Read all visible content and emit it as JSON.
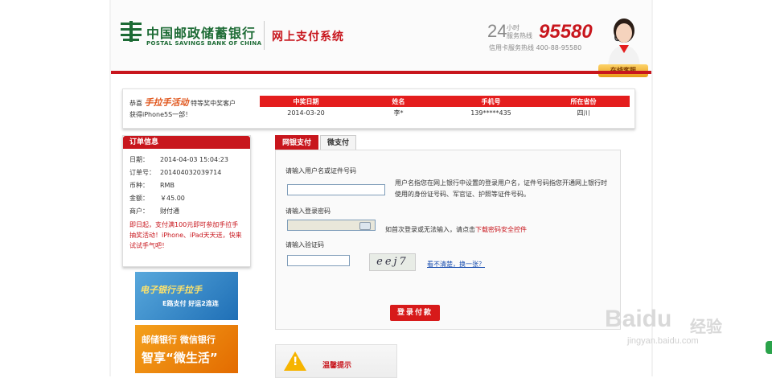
{
  "header": {
    "bank_name_cn": "中国邮政储蓄银行",
    "bank_name_en": "POSTAL SAVINGS BANK OF CHINA",
    "system_title": "网上支付系统",
    "hotline_24": "24",
    "hotline_small_1": "小时",
    "hotline_small_2": "服务热线",
    "hotline_number": "95580",
    "card_hotline": "信用卡服务热线   400-88-95580",
    "online_service": "在线客服"
  },
  "winner": {
    "line1_prefix": "恭喜",
    "promo_name": "手拉手活动",
    "line1_suffix": "特等奖中奖客户",
    "line2": "获得iPhone5S一部！",
    "columns": [
      "中奖日期",
      "姓名",
      "手机号",
      "所在省份"
    ],
    "row": [
      "2014-03-20",
      "李*",
      "139*****435",
      "四川"
    ]
  },
  "order": {
    "title": "订单信息",
    "rows": [
      {
        "k": "日期：",
        "v": "2014-04-03 15:04:23"
      },
      {
        "k": "订单号：",
        "v": "201404032039714"
      },
      {
        "k": "币种：",
        "v": "RMB"
      },
      {
        "k": "金额：",
        "v": "￥45.00"
      },
      {
        "k": "商户：",
        "v": "财付通"
      }
    ],
    "note": "即日起，支付满100元即可参加手拉手抽奖活动！iPhone、iPad天天送，快来试试手气吧！"
  },
  "ads": {
    "ad1_line1": "电子银行手拉手",
    "ad1_line2": "E路支付 好运2连连",
    "ad2_line1": "邮储银行 微信银行",
    "ad2_line2": "智享“微生活”"
  },
  "tabs": [
    {
      "label": "网银支付"
    },
    {
      "label": "微支付"
    }
  ],
  "form": {
    "username_label": "请输入用户名或证件号码",
    "username_value": "",
    "username_help": "用户名指您在网上银行中设置的登录用户名，证件号码指您开通网上银行时使用的身份证号码、军官证、护照等证件号码。",
    "password_label": "请输入登录密码",
    "password_help_prefix": "如首次登录或无法输入，请点击",
    "password_help_link": "下载密码安全控件",
    "captcha_label": "请输入验证码",
    "captcha_value": "",
    "captcha_text": "eej7",
    "captcha_refresh": "看不清楚，换一张？",
    "submit": "登录付款"
  },
  "tip": {
    "title": "温馨提示",
    "icon": "!"
  },
  "watermark": {
    "baidu": "Baidu",
    "jingyan": "经验",
    "url": "jingyan.baidu.com"
  },
  "colors": {
    "brand_red": "#c8161d",
    "brand_green": "#1d6b35"
  }
}
